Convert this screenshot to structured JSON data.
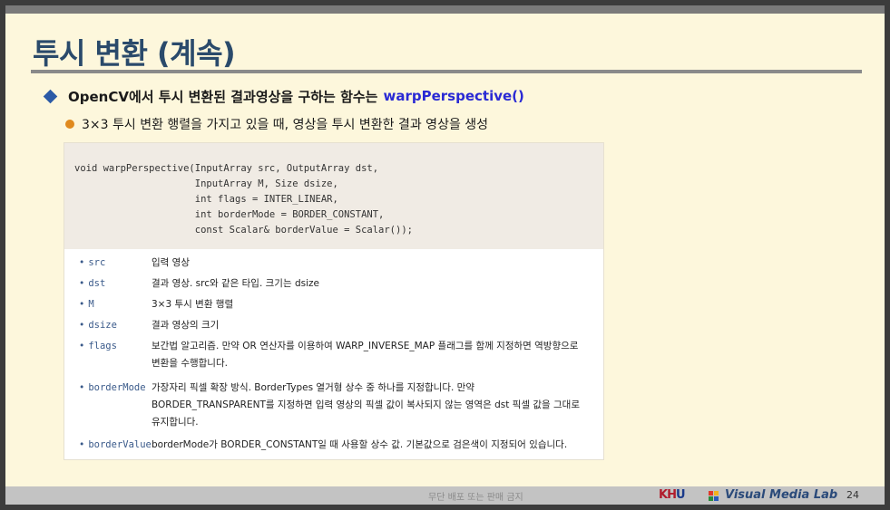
{
  "title": "투시 변환 (계속)",
  "bullet1": {
    "text": "OpenCV에서 투시 변환된 결과영상을 구하는 함수는",
    "highlight": "warpPerspective()"
  },
  "bullet2": {
    "text": "3×3 투시 변환 행렬을 가지고 있을 때, 영상을 투시 변환한 결과 영상을 생성"
  },
  "code": {
    "lines": [
      "void warpPerspective(InputArray src, OutputArray dst,",
      "                     InputArray M, Size dsize,",
      "                     int flags = INTER_LINEAR,",
      "                     int borderMode = BORDER_CONSTANT,",
      "                     const Scalar& borderValue = Scalar());"
    ]
  },
  "params": [
    {
      "name": "src",
      "desc": "입력 영상"
    },
    {
      "name": "dst",
      "desc": "결과 영상. src와 같은 타입. 크기는 dsize"
    },
    {
      "name": "M",
      "desc": "3×3 투시 변환 행렬"
    },
    {
      "name": "dsize",
      "desc": "결과 영상의 크기"
    },
    {
      "name": "flags",
      "desc": "보간법 알고리즘. 만약 OR 연산자를 이용하여 WARP_INVERSE_MAP 플래그를 함께 지정하면 역방향으로 변환을 수행합니다."
    },
    {
      "name": "borderMode",
      "desc": "가장자리 픽셀 확장 방식. BorderTypes 열거형 상수 중 하나를 지정합니다. 만약 BORDER_TRANSPARENT를 지정하면 입력 영상의 픽셀 값이 복사되지 않는 영역은 dst 픽셀 값을 그대로 유지합니다."
    },
    {
      "name": "borderValue",
      "desc": "borderMode가 BORDER_CONSTANT일 때 사용할 상수 값. 기본값으로 검은색이 지정되어 있습니다."
    }
  ],
  "footer": {
    "note": "무단 배포 또는 판매 금지",
    "khu_k": "K",
    "khu_h": "H",
    "khu_u": "U",
    "lab": "Visual Media Lab",
    "page": "24"
  },
  "colors": {
    "title": "#2a4a6b",
    "highlight": "#2a2ad4",
    "diamond": "#2b5aa6",
    "dot": "#e08a1e",
    "background": "#fdf7dc"
  }
}
